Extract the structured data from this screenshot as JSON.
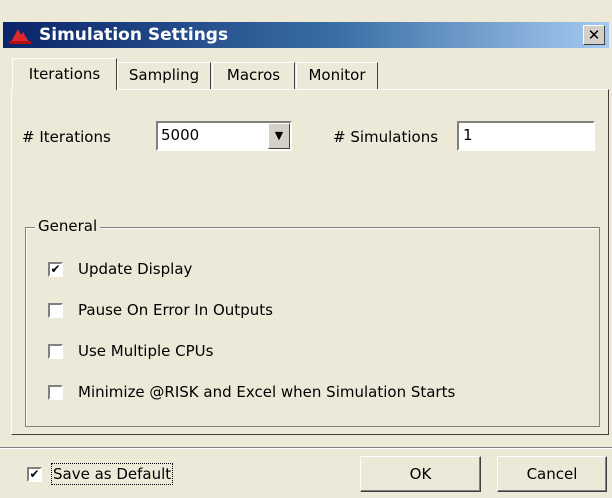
{
  "window": {
    "title": "Simulation Settings",
    "close_glyph": "✕",
    "app_icon": "risk-hat-icon",
    "title_gradient_start": "#0a246a",
    "title_gradient_end": "#a6caf0"
  },
  "tabs": [
    {
      "label": "Iterations",
      "active": true
    },
    {
      "label": "Sampling",
      "active": false
    },
    {
      "label": "Macros",
      "active": false
    },
    {
      "label": "Monitor",
      "active": false
    }
  ],
  "iterations": {
    "iterations_label": "# Iterations",
    "iterations_value": "5000",
    "dropdown_glyph": "▼",
    "simulations_label": "# Simulations",
    "simulations_value": "1"
  },
  "general": {
    "label": "General",
    "options": [
      {
        "label": "Update Display",
        "checked": true
      },
      {
        "label": "Pause On Error In Outputs",
        "checked": false
      },
      {
        "label": "Use Multiple CPUs",
        "checked": false
      },
      {
        "label": "Minimize @RISK and Excel when Simulation Starts",
        "checked": false
      }
    ]
  },
  "footer": {
    "save_default_label": "Save as Default",
    "save_default_checked": true,
    "ok_label": "OK",
    "cancel_label": "Cancel"
  },
  "check_glyph": "✔"
}
